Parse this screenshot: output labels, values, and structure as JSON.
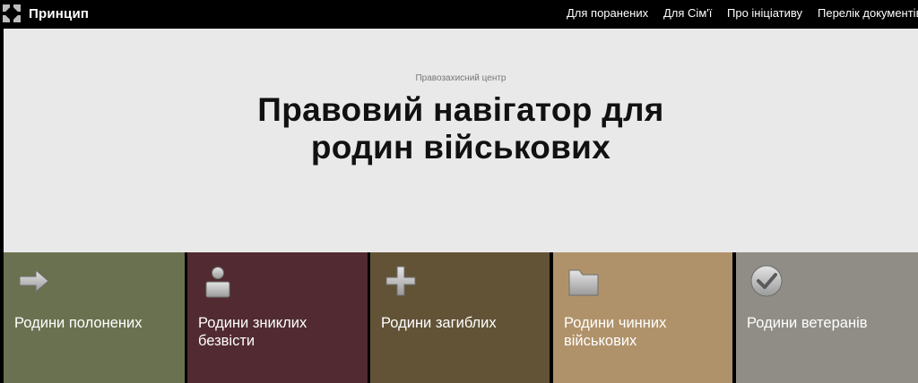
{
  "header": {
    "logo_text": "Принцип",
    "nav": [
      {
        "label": "Для поранених"
      },
      {
        "label": "Для Сім'ї"
      },
      {
        "label": "Про ініціативу"
      },
      {
        "label": "Перелік документів"
      }
    ]
  },
  "hero": {
    "subtitle": "Правозахисний центр",
    "title_line1": "Правовий навігатор для",
    "title_line2": "родин військових"
  },
  "cards": [
    {
      "label_line1": "Родини полонених",
      "label_line2": "",
      "icon": "arrow-right-icon",
      "color": "#6a7150"
    },
    {
      "label_line1": "Родини зниклих",
      "label_line2": "безвісти",
      "icon": "person-icon",
      "color": "#512b31"
    },
    {
      "label_line1": "Родини загиблих",
      "label_line2": "",
      "icon": "plus-icon",
      "color": "#625337"
    },
    {
      "label_line1": "Родини чинних",
      "label_line2": "військових",
      "icon": "folder-icon",
      "color": "#b0926a"
    },
    {
      "label_line1": "Родини ветеранів",
      "label_line2": "",
      "icon": "checkmark-circle-icon",
      "color": "#8f8d86"
    }
  ]
}
